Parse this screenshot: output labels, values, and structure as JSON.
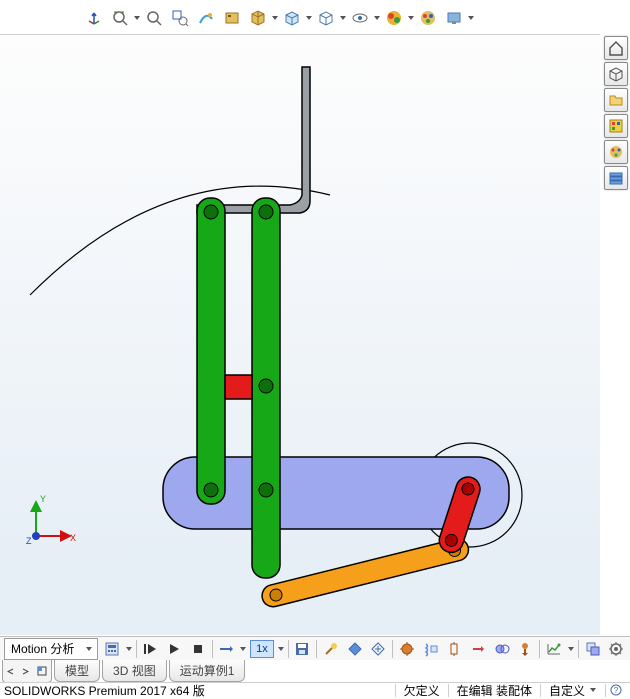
{
  "toolbar": {
    "icons": [
      "coord-sys",
      "zoom-fit",
      "magnify",
      "zoom-area",
      "free-view",
      "view-settings",
      "section-view",
      "display-style",
      "box-view",
      "view-orient",
      "render-style",
      "hide-show",
      "scene",
      "appearance",
      "display-pane"
    ]
  },
  "side": {
    "icons": [
      "home",
      "iso-cube",
      "folder",
      "globe",
      "appearance-panel",
      "options-panel"
    ]
  },
  "motion": {
    "combo_label": "Motion 分析",
    "speed": "1x"
  },
  "tabs": {
    "items": [
      "模型",
      "3D 视图",
      "运动算例1"
    ]
  },
  "status": {
    "product": "SOLIDWORKS Premium 2017 x64 版",
    "under_defined": "欠定义",
    "editing": "在编辑 装配体",
    "custom": "自定义"
  },
  "axes": {
    "x": "X",
    "y": "Y",
    "z": "Z"
  }
}
